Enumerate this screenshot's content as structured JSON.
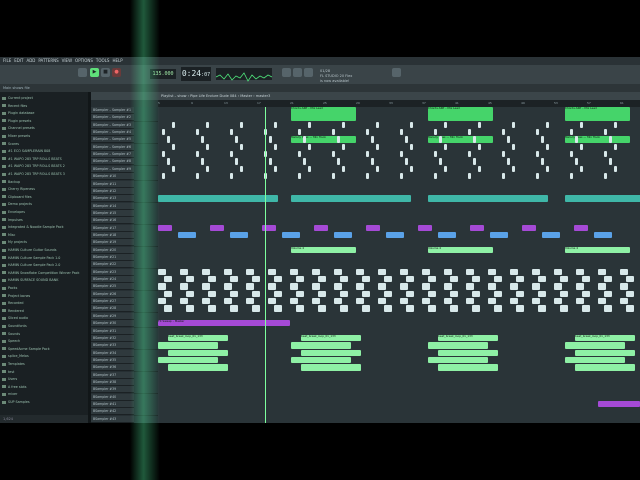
{
  "menubar": {
    "items": [
      "FILE",
      "EDIT",
      "ADD",
      "PATTERNS",
      "VIEW",
      "OPTIONS",
      "TOOLS",
      "HELP"
    ]
  },
  "transport": {
    "time": "0:24",
    "time_sub": ":07",
    "tempo": "135.000",
    "hint_line1": "01/28",
    "hint_line2": "FL STUDIO 20 Flex",
    "hint_line3": "is now available!"
  },
  "subbar": {
    "label": "Main shows file"
  },
  "browser": {
    "items": [
      "Current project",
      "Recent files",
      "Plugin database",
      "Plugin presets",
      "Channel presets",
      "Mixer presets",
      "Scores",
      "#1 ECO SAMPLERAIN 808",
      "#1 WAPO 285 TRP ROLLS BEATS",
      "#1 WAPO 285 TRP ROLLS BEATS 2",
      "#1 WAPO 285 TRP ROLLS BEATS 3",
      "Backup",
      "Cherry Ripeness",
      "Clipboard files",
      "Demo projects",
      "Envelopes",
      "Impulses",
      "Integrated & Noodle Sample Pack",
      "Misc",
      "My projects",
      "HAMIN Culture Guitar Sounds",
      "HAMIN Culture Sample Pack 1.0",
      "HAMIN Culture Sample Pack 2.0",
      "HAMIN Snowflake Competition Winner Pack",
      "HAMIN SURFACE SOUND BANK",
      "Packs",
      "Project bones",
      "Recorded",
      "Rendered",
      "Sliced audio",
      "Soundfonts",
      "Sounds",
      "Speech",
      "SpeedAcme Sample Pack",
      "splice_Melos",
      "Templates",
      "test",
      "Users",
      "A free slots",
      "mixer",
      "SUP Samples"
    ],
    "footer": "1,624"
  },
  "playlist": {
    "title": "Playlist – show › Pipe Life Endure Dude 084 › Master › master3",
    "ruler": [
      "5",
      "9",
      "13",
      "17",
      "21",
      "25",
      "29",
      "33",
      "37",
      "41",
      "45",
      "49",
      "53",
      "57",
      "61"
    ],
    "tracks": [
      "BSampler – Sampler #1",
      "BSampler – Sampler #2",
      "BSampler – Sampler #3",
      "BSampler – Sampler #4",
      "BSampler – Sampler #5",
      "BSampler – Sampler #6",
      "BSampler – Sampler #7",
      "BSampler – Sampler #8",
      "BSampler – Sampler #9",
      "BSampler #10",
      "BSampler #11",
      "BSampler #12",
      "BSampler #13",
      "BSampler #14",
      "BSampler #15",
      "BSampler #16",
      "BSampler #17",
      "BSampler #18",
      "BSampler #19",
      "BSampler #20",
      "BSampler #21",
      "BSampler #22",
      "BSampler #23",
      "BSampler #24",
      "BSampler #25",
      "BSampler #26",
      "BSampler #27",
      "BSampler #28",
      "BSampler #29",
      "BSampler #30",
      "BSampler #31",
      "BSampler #32",
      "BSampler #33",
      "BSampler #34",
      "BSampler #35",
      "BSampler #36",
      "BSampler #37",
      "BSampler #38",
      "BSampler #39",
      "BSampler #40",
      "BSampler #41",
      "BSampler #42",
      "BSampler #43"
    ],
    "clip_labels": {
      "melody": "Melody Bass — Mix Hook",
      "chords": "Chords ARP – Mix Lead",
      "volume": "Volume 4",
      "loop": "beat_break_loop_01_133",
      "fx": "FX Sweep – Master"
    }
  },
  "colors": {
    "green": "#45d46a",
    "light_green": "#8ef0a5",
    "teal": "#3fb7a8",
    "purple": "#a54ad6",
    "blue": "#5aa2e8",
    "white": "#d8e8ea",
    "playhead": "#7dff9d"
  }
}
